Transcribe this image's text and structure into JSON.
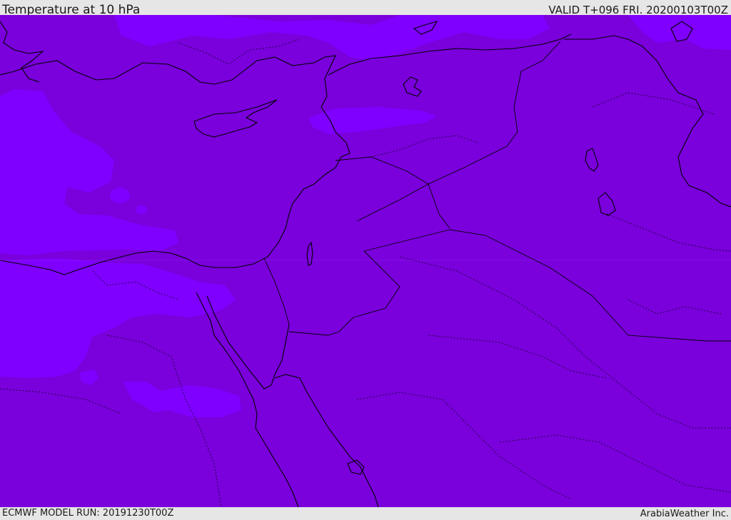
{
  "header": {
    "title": "Temperature at 10 hPa",
    "valid": "VALID T+096 FRI. 20200103T00Z"
  },
  "footer": {
    "model_run": "ECMWF MODEL RUN: 20191230T00Z",
    "credit": "ArabiaWeather Inc."
  },
  "map": {
    "background_color": "#7a00dc",
    "warm_patch_color": "#7f00ff",
    "coastline_color": "#000000",
    "border_style": "dotted"
  }
}
